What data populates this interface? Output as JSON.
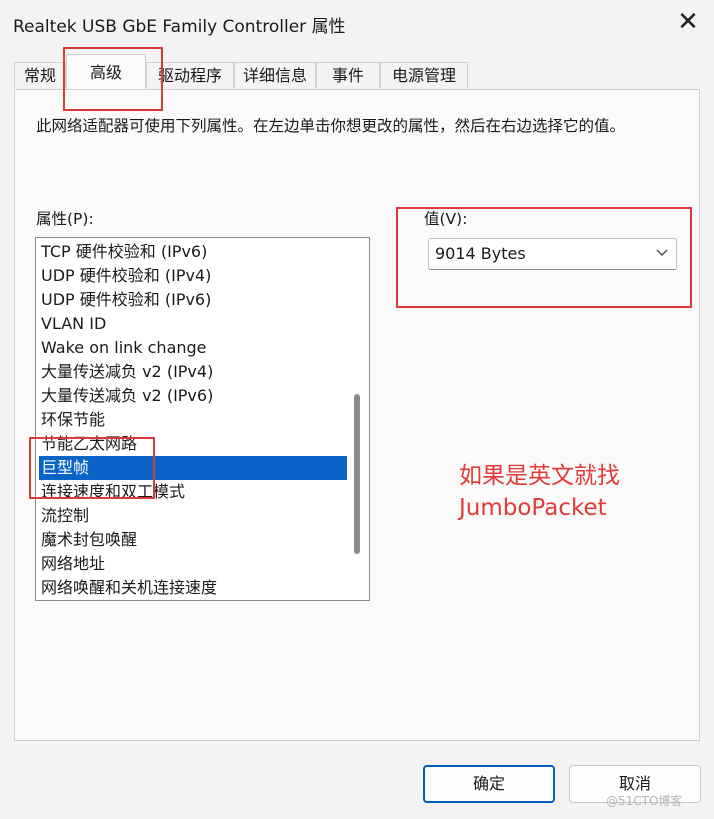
{
  "window": {
    "title": "Realtek USB GbE Family Controller 属性",
    "close_icon": "close-icon"
  },
  "tabs": [
    {
      "label": "常规"
    },
    {
      "label": "高级",
      "active": true
    },
    {
      "label": "驱动程序"
    },
    {
      "label": "详细信息"
    },
    {
      "label": "事件"
    },
    {
      "label": "电源管理"
    }
  ],
  "description": "此网络适配器可使用下列属性。在左边单击你想更改的属性，然后在右边选择它的值。",
  "property": {
    "label": "属性(P):",
    "items": [
      {
        "label": "TCP 硬件校验和 (IPv6)"
      },
      {
        "label": "UDP 硬件校验和 (IPv4)"
      },
      {
        "label": "UDP 硬件校验和 (IPv6)"
      },
      {
        "label": "VLAN ID"
      },
      {
        "label": "Wake on link change"
      },
      {
        "label": "大量传送减负 v2 (IPv4)"
      },
      {
        "label": "大量传送减负 v2 (IPv6)"
      },
      {
        "label": "环保节能"
      },
      {
        "label": "节能乙太网路"
      },
      {
        "label": "巨型帧",
        "selected": true
      },
      {
        "label": "连接速度和双工模式"
      },
      {
        "label": "流控制"
      },
      {
        "label": "魔术封包唤醒"
      },
      {
        "label": "网络地址"
      },
      {
        "label": "网络唤醒和关机连接速度"
      }
    ]
  },
  "value": {
    "label": "值(V):",
    "selected": "9014 Bytes",
    "dropdown_icon": "chevron-down-icon"
  },
  "annotation": {
    "line1": "如果是英文就找",
    "line2": "JumboPacket",
    "color": "#e23a3a"
  },
  "buttons": {
    "ok": "确定",
    "cancel": "取消"
  },
  "watermark": "@51CTO博客",
  "colors": {
    "selection": "#0a64c8",
    "highlight_box": "#d93a3a",
    "primary_border": "#005fb8"
  }
}
